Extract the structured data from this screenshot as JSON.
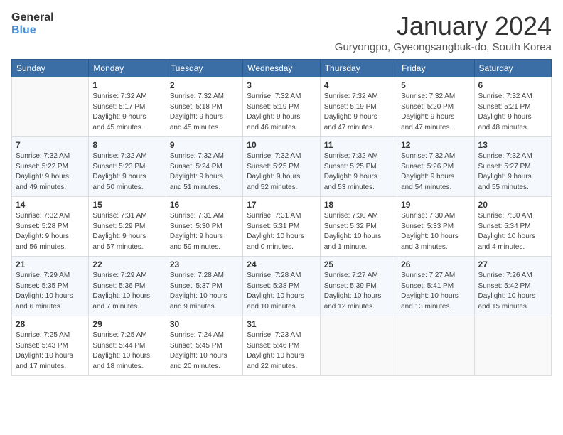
{
  "logo": {
    "line1": "General",
    "line2": "Blue"
  },
  "title": "January 2024",
  "location": "Guryongpo, Gyeongsangbuk-do, South Korea",
  "weekdays": [
    "Sunday",
    "Monday",
    "Tuesday",
    "Wednesday",
    "Thursday",
    "Friday",
    "Saturday"
  ],
  "weeks": [
    [
      {
        "day": "",
        "info": ""
      },
      {
        "day": "1",
        "info": "Sunrise: 7:32 AM\nSunset: 5:17 PM\nDaylight: 9 hours\nand 45 minutes."
      },
      {
        "day": "2",
        "info": "Sunrise: 7:32 AM\nSunset: 5:18 PM\nDaylight: 9 hours\nand 45 minutes."
      },
      {
        "day": "3",
        "info": "Sunrise: 7:32 AM\nSunset: 5:19 PM\nDaylight: 9 hours\nand 46 minutes."
      },
      {
        "day": "4",
        "info": "Sunrise: 7:32 AM\nSunset: 5:19 PM\nDaylight: 9 hours\nand 47 minutes."
      },
      {
        "day": "5",
        "info": "Sunrise: 7:32 AM\nSunset: 5:20 PM\nDaylight: 9 hours\nand 47 minutes."
      },
      {
        "day": "6",
        "info": "Sunrise: 7:32 AM\nSunset: 5:21 PM\nDaylight: 9 hours\nand 48 minutes."
      }
    ],
    [
      {
        "day": "7",
        "info": "Sunrise: 7:32 AM\nSunset: 5:22 PM\nDaylight: 9 hours\nand 49 minutes."
      },
      {
        "day": "8",
        "info": "Sunrise: 7:32 AM\nSunset: 5:23 PM\nDaylight: 9 hours\nand 50 minutes."
      },
      {
        "day": "9",
        "info": "Sunrise: 7:32 AM\nSunset: 5:24 PM\nDaylight: 9 hours\nand 51 minutes."
      },
      {
        "day": "10",
        "info": "Sunrise: 7:32 AM\nSunset: 5:25 PM\nDaylight: 9 hours\nand 52 minutes."
      },
      {
        "day": "11",
        "info": "Sunrise: 7:32 AM\nSunset: 5:25 PM\nDaylight: 9 hours\nand 53 minutes."
      },
      {
        "day": "12",
        "info": "Sunrise: 7:32 AM\nSunset: 5:26 PM\nDaylight: 9 hours\nand 54 minutes."
      },
      {
        "day": "13",
        "info": "Sunrise: 7:32 AM\nSunset: 5:27 PM\nDaylight: 9 hours\nand 55 minutes."
      }
    ],
    [
      {
        "day": "14",
        "info": "Sunrise: 7:32 AM\nSunset: 5:28 PM\nDaylight: 9 hours\nand 56 minutes."
      },
      {
        "day": "15",
        "info": "Sunrise: 7:31 AM\nSunset: 5:29 PM\nDaylight: 9 hours\nand 57 minutes."
      },
      {
        "day": "16",
        "info": "Sunrise: 7:31 AM\nSunset: 5:30 PM\nDaylight: 9 hours\nand 59 minutes."
      },
      {
        "day": "17",
        "info": "Sunrise: 7:31 AM\nSunset: 5:31 PM\nDaylight: 10 hours\nand 0 minutes."
      },
      {
        "day": "18",
        "info": "Sunrise: 7:30 AM\nSunset: 5:32 PM\nDaylight: 10 hours\nand 1 minute."
      },
      {
        "day": "19",
        "info": "Sunrise: 7:30 AM\nSunset: 5:33 PM\nDaylight: 10 hours\nand 3 minutes."
      },
      {
        "day": "20",
        "info": "Sunrise: 7:30 AM\nSunset: 5:34 PM\nDaylight: 10 hours\nand 4 minutes."
      }
    ],
    [
      {
        "day": "21",
        "info": "Sunrise: 7:29 AM\nSunset: 5:35 PM\nDaylight: 10 hours\nand 6 minutes."
      },
      {
        "day": "22",
        "info": "Sunrise: 7:29 AM\nSunset: 5:36 PM\nDaylight: 10 hours\nand 7 minutes."
      },
      {
        "day": "23",
        "info": "Sunrise: 7:28 AM\nSunset: 5:37 PM\nDaylight: 10 hours\nand 9 minutes."
      },
      {
        "day": "24",
        "info": "Sunrise: 7:28 AM\nSunset: 5:38 PM\nDaylight: 10 hours\nand 10 minutes."
      },
      {
        "day": "25",
        "info": "Sunrise: 7:27 AM\nSunset: 5:39 PM\nDaylight: 10 hours\nand 12 minutes."
      },
      {
        "day": "26",
        "info": "Sunrise: 7:27 AM\nSunset: 5:41 PM\nDaylight: 10 hours\nand 13 minutes."
      },
      {
        "day": "27",
        "info": "Sunrise: 7:26 AM\nSunset: 5:42 PM\nDaylight: 10 hours\nand 15 minutes."
      }
    ],
    [
      {
        "day": "28",
        "info": "Sunrise: 7:25 AM\nSunset: 5:43 PM\nDaylight: 10 hours\nand 17 minutes."
      },
      {
        "day": "29",
        "info": "Sunrise: 7:25 AM\nSunset: 5:44 PM\nDaylight: 10 hours\nand 18 minutes."
      },
      {
        "day": "30",
        "info": "Sunrise: 7:24 AM\nSunset: 5:45 PM\nDaylight: 10 hours\nand 20 minutes."
      },
      {
        "day": "31",
        "info": "Sunrise: 7:23 AM\nSunset: 5:46 PM\nDaylight: 10 hours\nand 22 minutes."
      },
      {
        "day": "",
        "info": ""
      },
      {
        "day": "",
        "info": ""
      },
      {
        "day": "",
        "info": ""
      }
    ]
  ]
}
